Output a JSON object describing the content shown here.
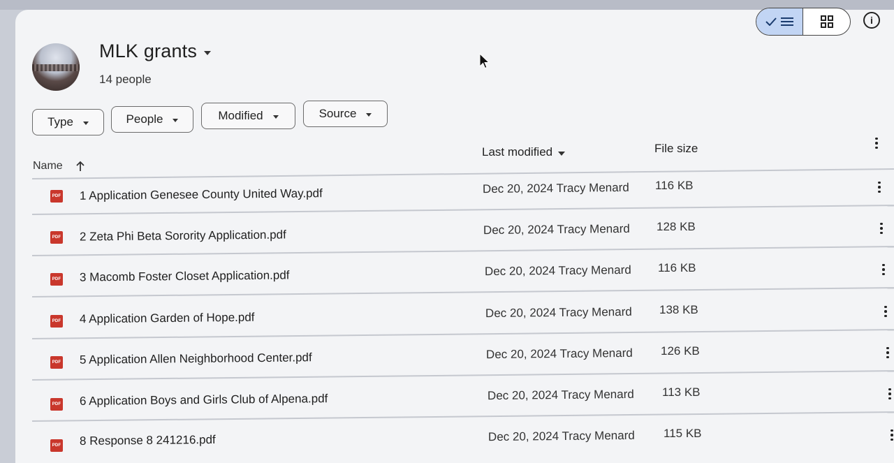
{
  "header": {
    "title": "MLK grants",
    "people": "14 people"
  },
  "filters": [
    "Type",
    "People",
    "Modified",
    "Source"
  ],
  "columns": {
    "name": "Name",
    "modified": "Last modified",
    "size": "File size"
  },
  "rows": [
    {
      "name": "1 Application Genesee County United Way.pdf",
      "modified": "Dec 20, 2024 Tracy Menard",
      "size": "116 KB"
    },
    {
      "name": "2 Zeta Phi Beta Sorority Application.pdf",
      "modified": "Dec 20, 2024 Tracy Menard",
      "size": "128 KB"
    },
    {
      "name": "3 Macomb Foster Closet Application.pdf",
      "modified": "Dec 20, 2024 Tracy Menard",
      "size": "116 KB"
    },
    {
      "name": "4 Application Garden of Hope.pdf",
      "modified": "Dec 20, 2024 Tracy Menard",
      "size": "138 KB"
    },
    {
      "name": "5 Application Allen Neighborhood Center.pdf",
      "modified": "Dec 20, 2024 Tracy Menard",
      "size": "126 KB"
    },
    {
      "name": "6 Application Boys and Girls Club of Alpena.pdf",
      "modified": "Dec 20, 2024 Tracy Menard",
      "size": "113 KB"
    },
    {
      "name": "8 Response  8  241216.pdf",
      "modified": "Dec 20, 2024 Tracy Menard",
      "size": "115 KB"
    }
  ],
  "icons": {
    "file": "pdf-icon",
    "file_label": "PDF",
    "sort": "arrow-up-icon",
    "view_list": "check-list-icon",
    "view_grid": "grid-icon",
    "info": "info-icon",
    "info_glyph": "i"
  },
  "colors": {
    "pdf": "#c9372c",
    "toggle_active": "#c2d5f4"
  }
}
